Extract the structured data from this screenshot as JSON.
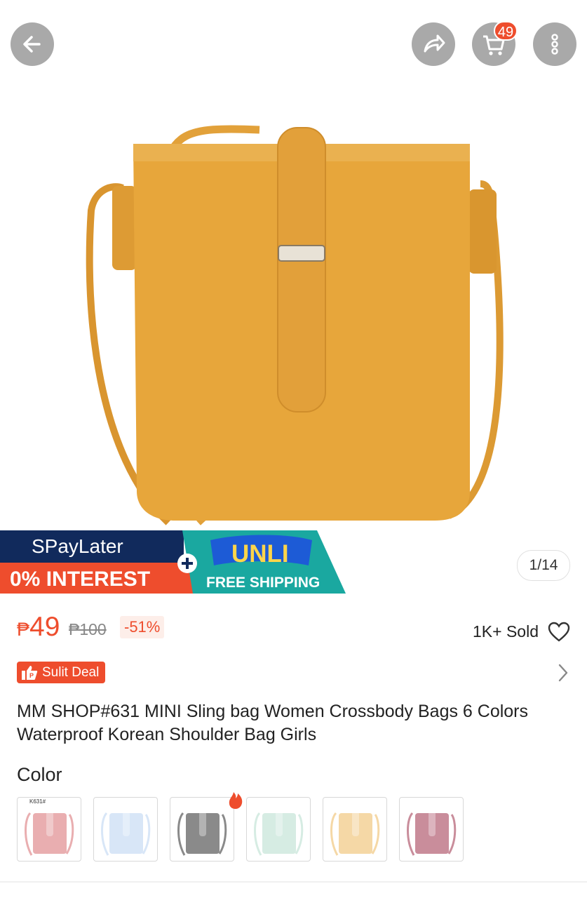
{
  "header": {
    "back_icon": "arrow-left-icon",
    "share_icon": "share-icon",
    "cart_icon": "cart-icon",
    "cart_count": "49",
    "more_icon": "more-vertical-icon"
  },
  "gallery": {
    "counter": "1/14",
    "product_color": "#e7a63b"
  },
  "promo_banner": {
    "spaylater": "SPayLater",
    "interest": "0% INTEREST",
    "unli": "UNLI",
    "free_shipping": "FREE SHIPPING"
  },
  "price": {
    "currency": "₱",
    "current": "49",
    "original": "₱100",
    "discount": "-51%",
    "sold": "1K+ Sold"
  },
  "deal_badge": {
    "label": "Sulit Deal"
  },
  "product": {
    "title": "MM SHOP#631 MINI Sling bag Women Crossbody Bags 6 Colors Waterproof Korean Shoulder Bag Girls"
  },
  "variations": {
    "label": "Color",
    "first_tag": "K631#",
    "swatches": [
      {
        "color": "#e9aeb0"
      },
      {
        "color": "#d8e6f7"
      },
      {
        "color": "#8a8a8a"
      },
      {
        "color": "#d6ece3"
      },
      {
        "color": "#f5d8a6"
      },
      {
        "color": "#c98d9b"
      }
    ]
  },
  "colors": {
    "accent": "#ee4d2d",
    "banner_navy": "#112a5c",
    "banner_teal": "#1aa8a0"
  }
}
